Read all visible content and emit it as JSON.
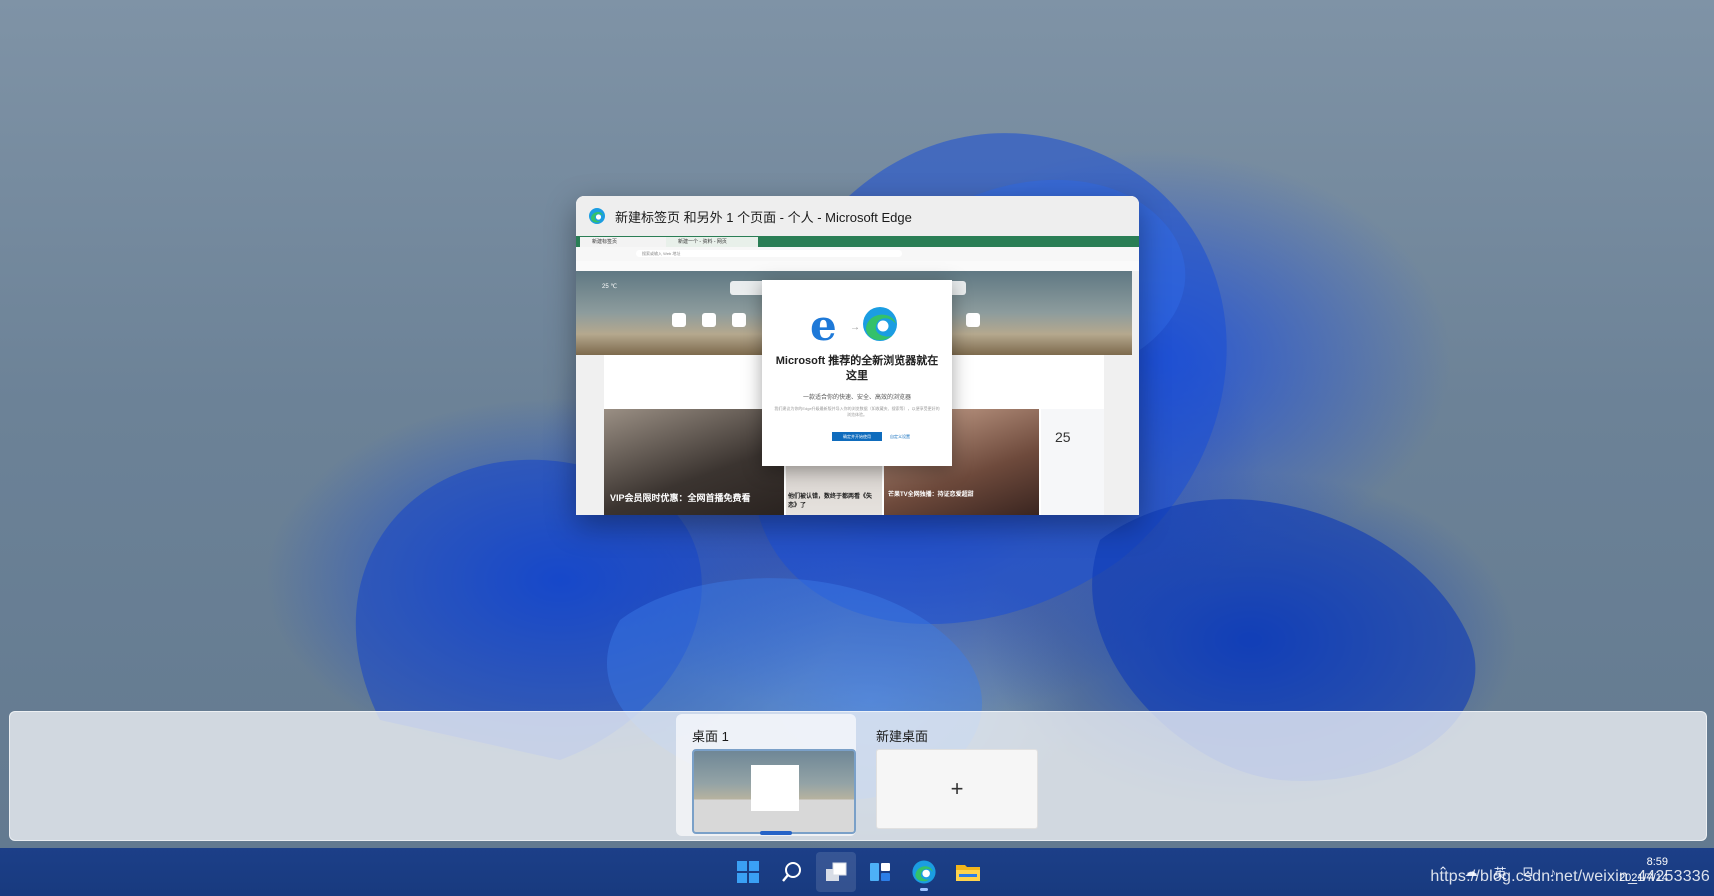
{
  "window": {
    "title": "新建标签页 和另外 1 个页面 - 个人 - Microsoft Edge",
    "app_icon": "edge-icon"
  },
  "browser_preview": {
    "tabs": [
      "新建标签页",
      "新建一个 - 资料 - 网页"
    ],
    "address": "搜索或输入 Web 地址",
    "weather": "25 ℃",
    "news_headlines": [
      "VIP会员限时优惠：全网首播免费看",
      "他们被认错，数终于都两看《失恋》了",
      "芒果TV全网独播：持证恋爱超甜"
    ]
  },
  "modal": {
    "title": "Microsoft 推荐的全新浏览器就在这里",
    "subtitle": "一款适合你的快速、安全、高效的浏览器",
    "body": "我们建议为你的Edge升级最新版并导入你的浏览数据（如收藏夹、搜索等），以便享受更好的浏览体验。",
    "confirm_label": "确定并开始使用",
    "custom_label": "自定义设置"
  },
  "desktops": {
    "desktop1_label": "桌面 1",
    "new_desktop_label": "新建桌面",
    "add_symbol": "+"
  },
  "taskbar": {
    "icons": [
      "windows-start-icon",
      "search-icon",
      "task-view-icon",
      "widgets-icon",
      "edge-icon",
      "file-explorer-icon"
    ],
    "accent": "#1c3f88"
  },
  "tray": {
    "ime": "英",
    "time": "8:59",
    "date": "2021/7/14"
  },
  "watermark": "https://blog.csdn.net/weixin_44253336"
}
